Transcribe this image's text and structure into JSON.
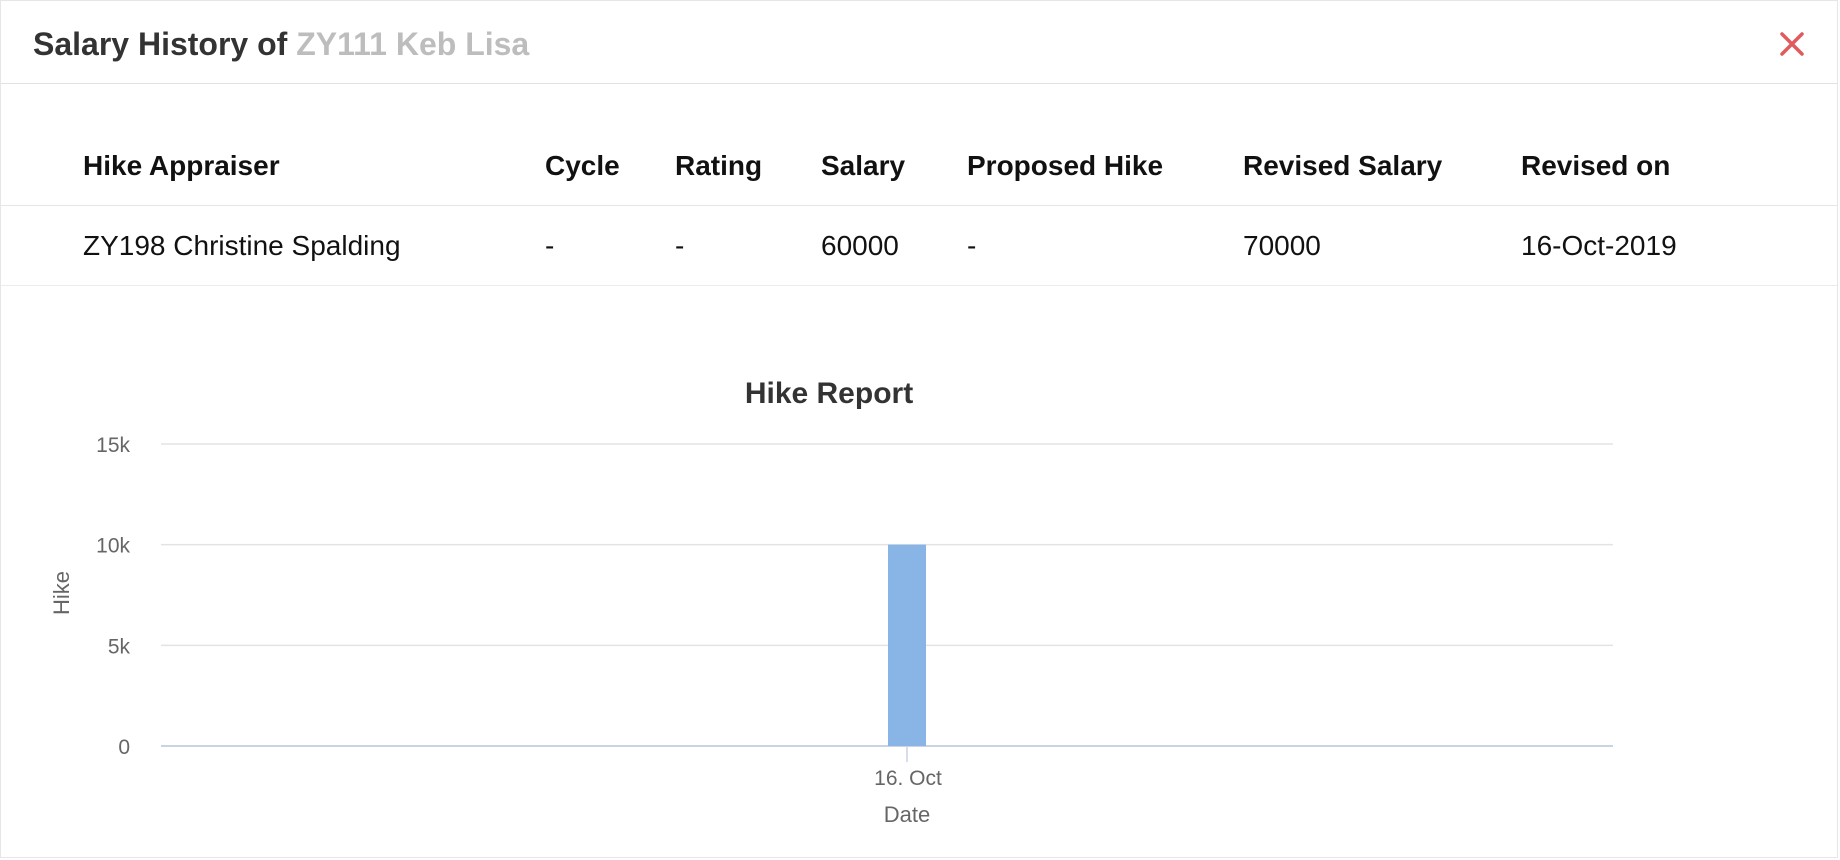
{
  "dialog": {
    "title_prefix": "Salary History of",
    "employee": "ZY111 Keb Lisa",
    "close_icon": "close-icon",
    "close_color": "#e05a5f"
  },
  "table": {
    "columns": [
      "Hike Appraiser",
      "Cycle",
      "Rating",
      "Salary",
      "Proposed Hike",
      "Revised Salary",
      "Revised on"
    ],
    "rows": [
      [
        "ZY198 Christine Spalding",
        "-",
        "-",
        "60000",
        "-",
        "70000",
        "16-Oct-2019"
      ]
    ]
  },
  "chart_data": {
    "type": "bar",
    "title": "Hike Report",
    "xlabel": "Date",
    "ylabel": "Hike",
    "categories": [
      "16. Oct"
    ],
    "values": [
      10000
    ],
    "ylim": [
      0,
      15000
    ],
    "yticks": [
      0,
      5000,
      10000,
      15000
    ],
    "ytick_labels": [
      "0",
      "5k",
      "10k",
      "15k"
    ],
    "grid": true,
    "bar_color": "#88b4e6"
  }
}
